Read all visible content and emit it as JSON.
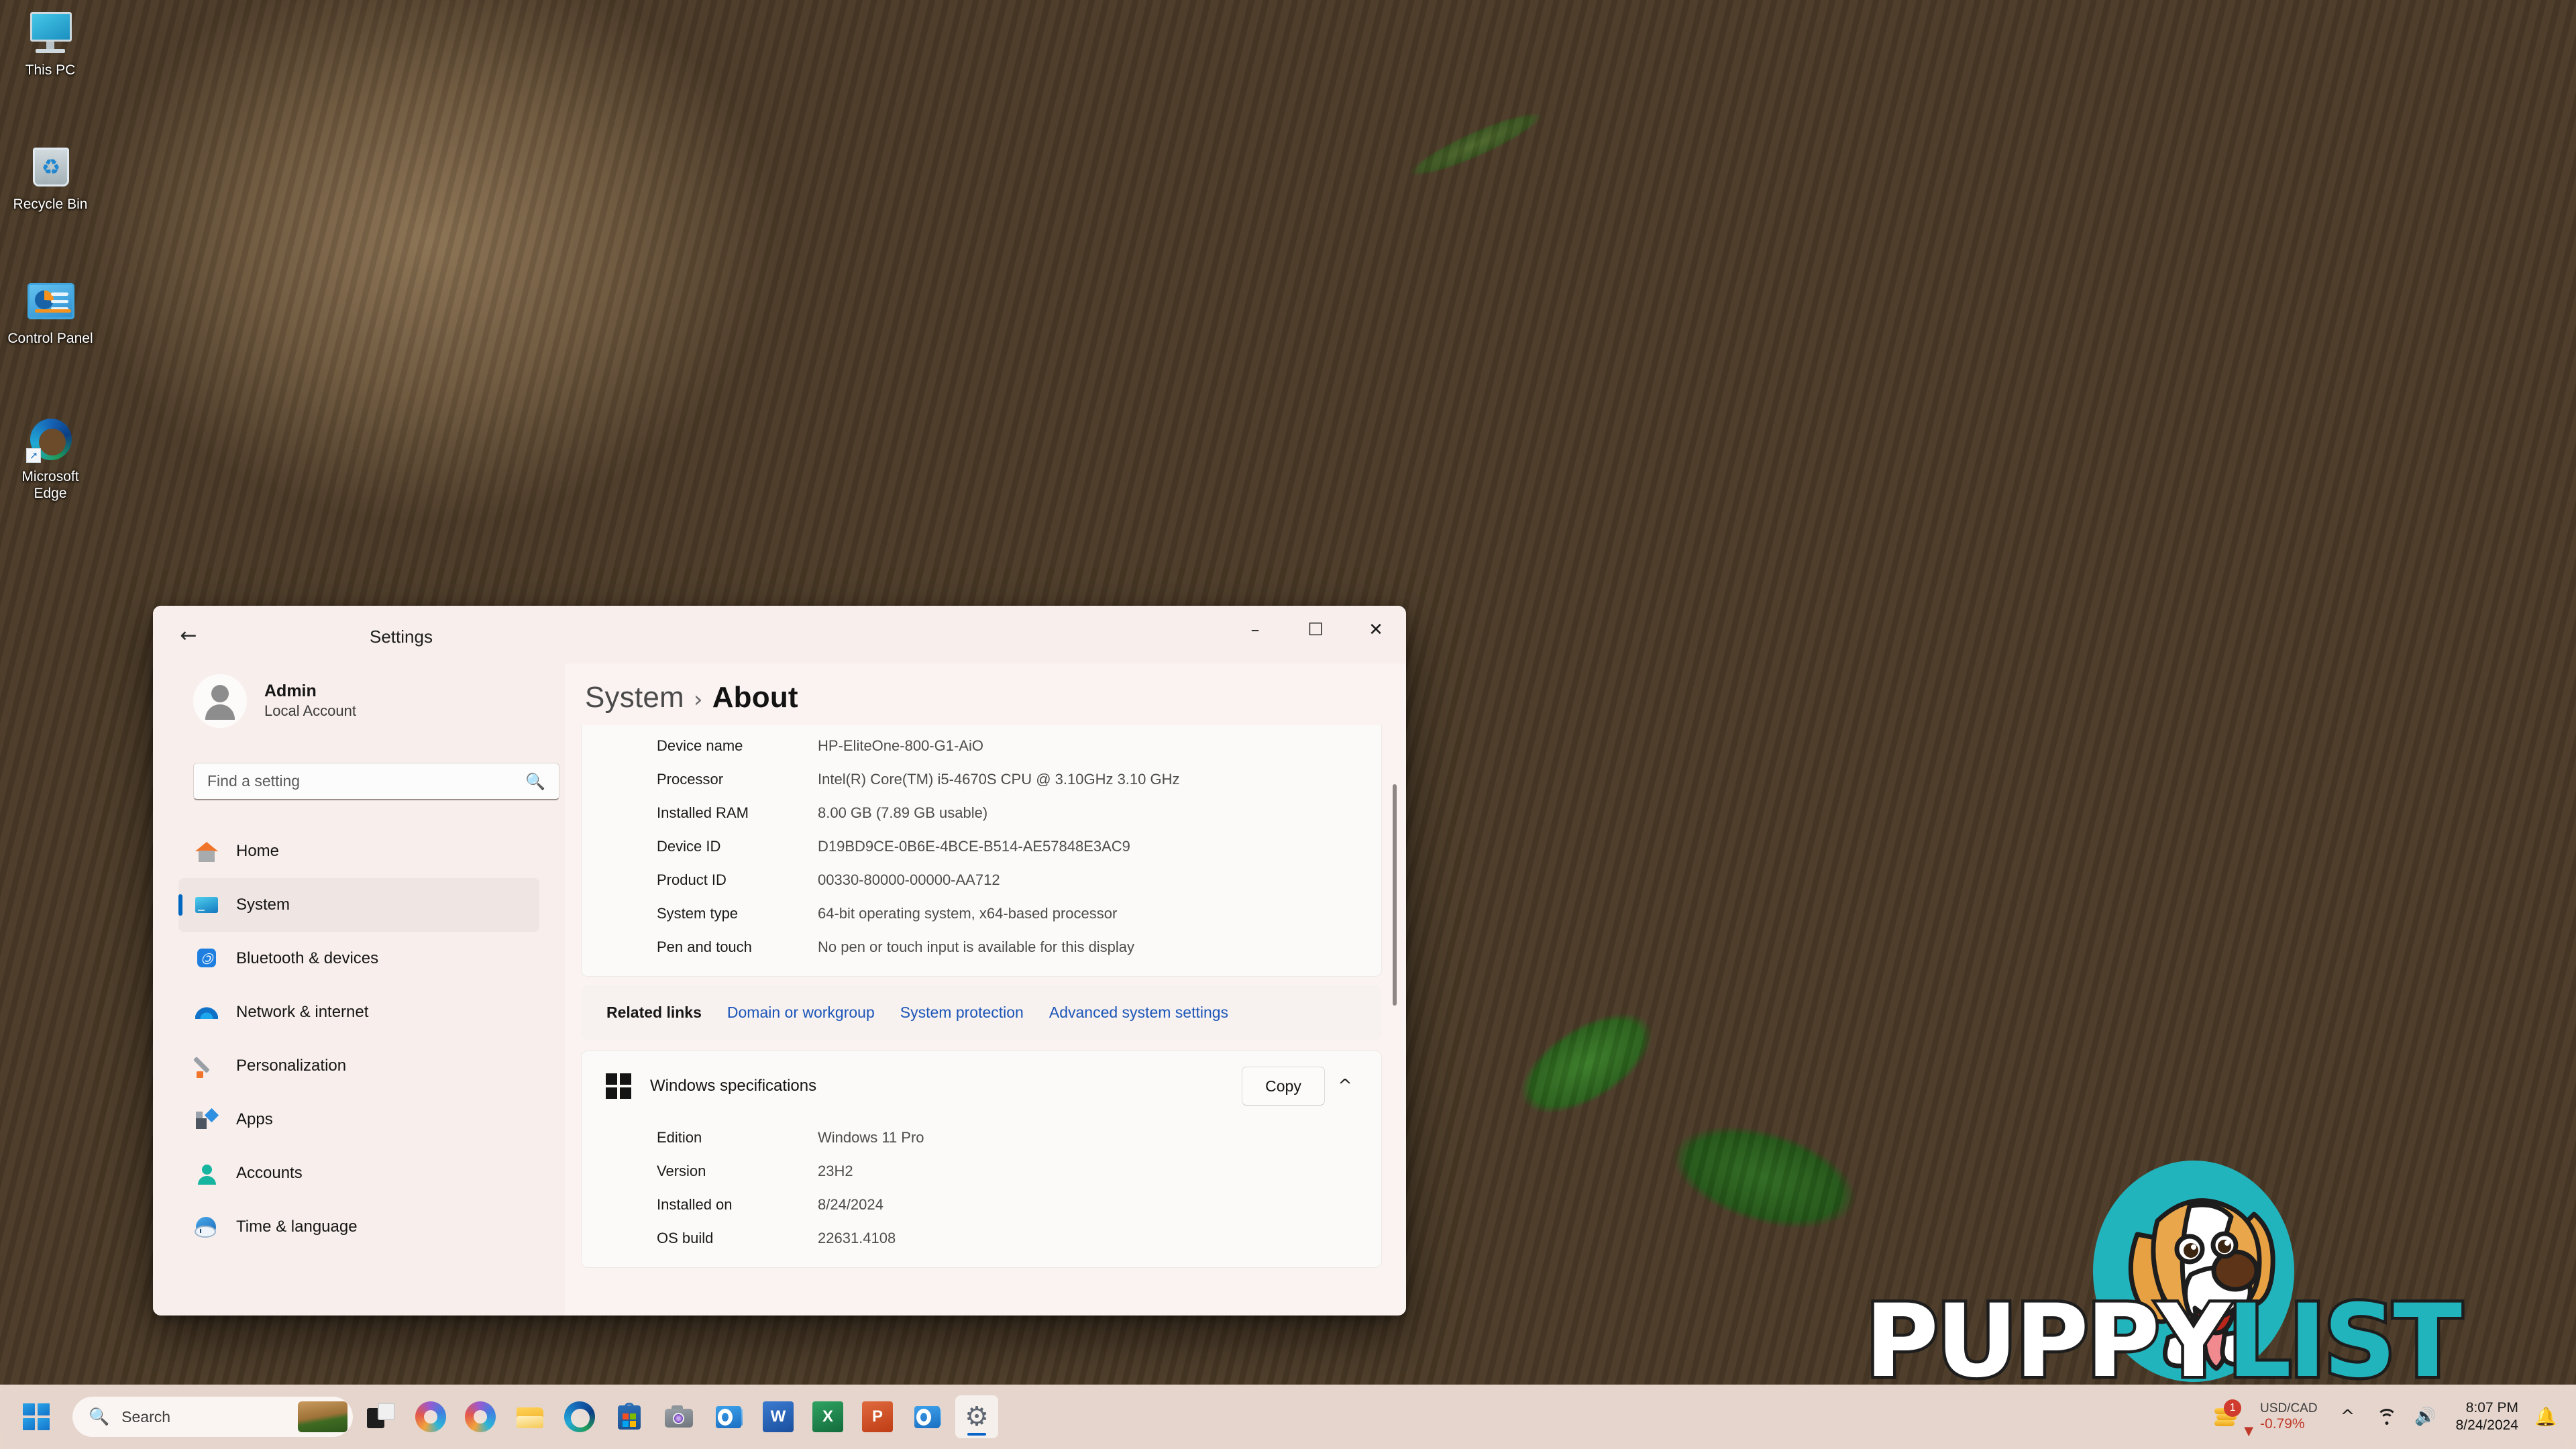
{
  "desktop": {
    "icons": [
      {
        "label": "This PC",
        "icon": "this-pc-icon"
      },
      {
        "label": "Recycle Bin",
        "icon": "recycle-bin-icon"
      },
      {
        "label": "Control Panel",
        "icon": "control-panel-icon"
      },
      {
        "label": "Microsoft\nEdge",
        "icon": "microsoft-edge-icon"
      }
    ]
  },
  "watermark": {
    "word1": "PUPPY",
    "word2": "LIST",
    "colors": {
      "teal": "#22b4bd",
      "white": "#ffffff"
    }
  },
  "window": {
    "title": "Settings",
    "back_icon": "back-arrow-icon",
    "controls": {
      "minimize": "–",
      "maximize": "☐",
      "close": "✕"
    }
  },
  "sidebar": {
    "account": {
      "name": "Admin",
      "type": "Local Account",
      "avatar": "user-avatar-icon"
    },
    "search": {
      "placeholder": "Find a setting",
      "value": "",
      "icon": "search-icon"
    },
    "items": [
      {
        "label": "Home",
        "icon": "home-icon",
        "active": false
      },
      {
        "label": "System",
        "icon": "system-monitor-icon",
        "active": true
      },
      {
        "label": "Bluetooth & devices",
        "icon": "bluetooth-icon",
        "active": false
      },
      {
        "label": "Network & internet",
        "icon": "wifi-icon",
        "active": false
      },
      {
        "label": "Personalization",
        "icon": "paintbrush-icon",
        "active": false
      },
      {
        "label": "Apps",
        "icon": "apps-grid-icon",
        "active": false
      },
      {
        "label": "Accounts",
        "icon": "account-person-icon",
        "active": false
      },
      {
        "label": "Time & language",
        "icon": "clock-globe-icon",
        "active": false
      }
    ]
  },
  "main": {
    "breadcrumb": {
      "parent": "System",
      "separator": "›",
      "current": "About"
    },
    "device_specs": {
      "rows": [
        {
          "key": "Device name",
          "value": "HP-EliteOne-800-G1-AiO"
        },
        {
          "key": "Processor",
          "value": "Intel(R) Core(TM) i5-4670S CPU @ 3.10GHz   3.10 GHz"
        },
        {
          "key": "Installed RAM",
          "value": "8.00 GB (7.89 GB usable)"
        },
        {
          "key": "Device ID",
          "value": "D19BD9CE-0B6E-4BCE-B514-AE57848E3AC9"
        },
        {
          "key": "Product ID",
          "value": "00330-80000-00000-AA712"
        },
        {
          "key": "System type",
          "value": "64-bit operating system, x64-based processor"
        },
        {
          "key": "Pen and touch",
          "value": "No pen or touch input is available for this display"
        }
      ]
    },
    "related_links": {
      "label": "Related links",
      "links": [
        "Domain or workgroup",
        "System protection",
        "Advanced system settings"
      ],
      "link_color": "#1b55b8"
    },
    "windows_specifications": {
      "title": "Windows specifications",
      "icon": "windows-logo-icon",
      "copy_label": "Copy",
      "collapse_icon": "chevron-up-icon",
      "rows": [
        {
          "key": "Edition",
          "value": "Windows 11 Pro"
        },
        {
          "key": "Version",
          "value": "23H2"
        },
        {
          "key": "Installed on",
          "value": "8/24/2024"
        },
        {
          "key": "OS build",
          "value": "22631.4108"
        }
      ]
    }
  },
  "taskbar": {
    "start": {
      "icon": "windows-start-icon"
    },
    "search": {
      "placeholder": "Search",
      "icon": "search-icon"
    },
    "items": [
      {
        "name": "task-view",
        "icon": "task-view-icon"
      },
      {
        "name": "copilot",
        "icon": "copilot-icon"
      },
      {
        "name": "copilot-2",
        "icon": "copilot-icon"
      },
      {
        "name": "file-explorer",
        "icon": "file-explorer-icon"
      },
      {
        "name": "microsoft-edge",
        "icon": "microsoft-edge-icon"
      },
      {
        "name": "microsoft-store",
        "icon": "microsoft-store-icon"
      },
      {
        "name": "camera",
        "icon": "camera-icon"
      },
      {
        "name": "outlook",
        "icon": "outlook-icon"
      },
      {
        "name": "word",
        "icon": "word-icon",
        "letter": "W"
      },
      {
        "name": "excel",
        "icon": "excel-icon",
        "letter": "X"
      },
      {
        "name": "powerpoint",
        "icon": "powerpoint-icon",
        "letter": "P"
      },
      {
        "name": "outlook-2",
        "icon": "outlook-icon"
      },
      {
        "name": "settings",
        "icon": "settings-gear-icon",
        "active": true
      }
    ],
    "widget": {
      "symbol": "USD/CAD",
      "change": "-0.79%",
      "badge": "1",
      "trend_icon": "arrow-down-icon"
    },
    "tray": {
      "overflow_icon": "chevron-up-icon",
      "wifi_icon": "wifi-icon",
      "volume_icon": "speaker-icon",
      "time": "8:07 PM",
      "date": "8/24/2024",
      "notification_icon": "bell-icon"
    }
  }
}
